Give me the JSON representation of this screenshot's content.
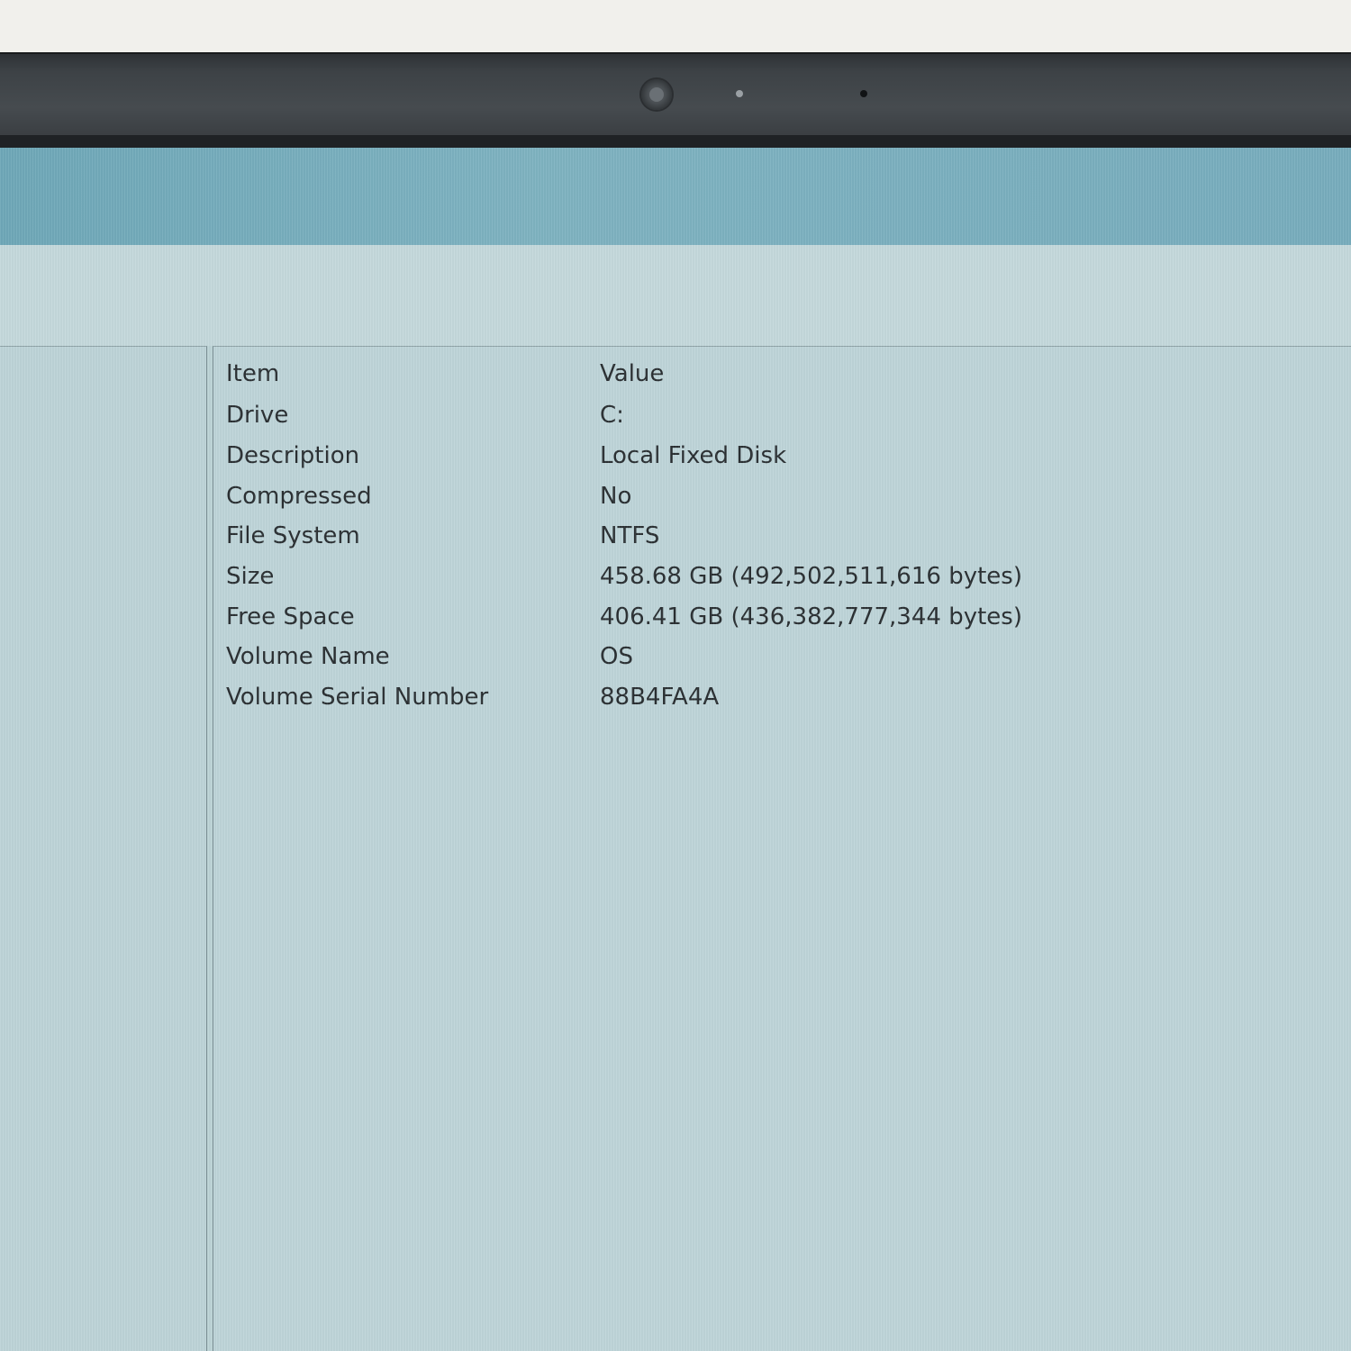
{
  "table": {
    "columns": [
      "Item",
      "Value"
    ],
    "rows": [
      {
        "item": "Drive",
        "value": "C:"
      },
      {
        "item": "Description",
        "value": "Local Fixed Disk"
      },
      {
        "item": "Compressed",
        "value": "No"
      },
      {
        "item": "File System",
        "value": "NTFS"
      },
      {
        "item": "Size",
        "value": "458.68 GB (492,502,511,616 bytes)"
      },
      {
        "item": "Free Space",
        "value": "406.41 GB (436,382,777,344 bytes)"
      },
      {
        "item": "Volume Name",
        "value": "OS"
      },
      {
        "item": "Volume Serial Number",
        "value": "88B4FA4A"
      }
    ]
  },
  "colors": {
    "titlebar": "#7fb3c1",
    "window_background": "#bed5d9",
    "text": "#2a2f32",
    "bezel": "#44494d"
  }
}
